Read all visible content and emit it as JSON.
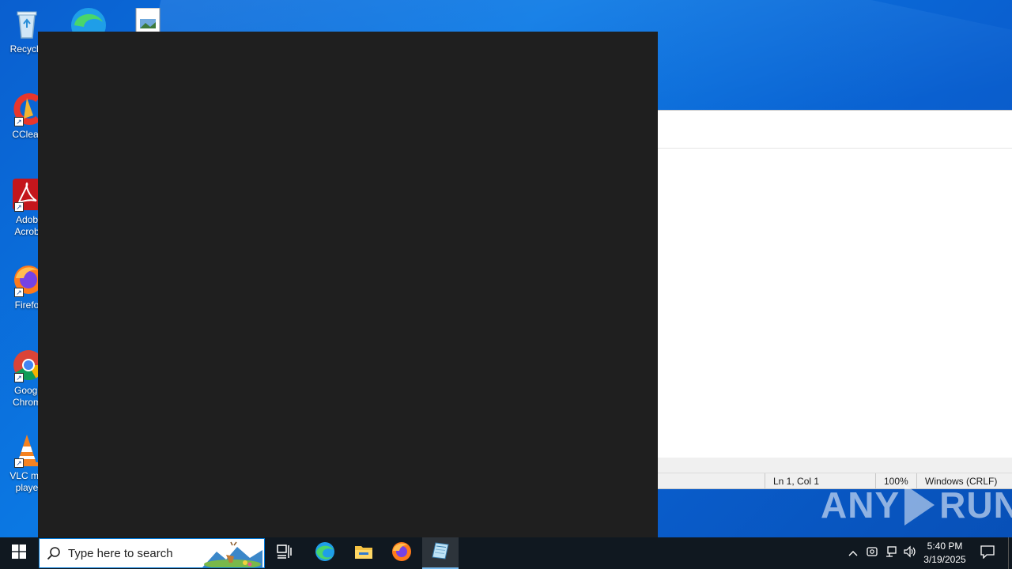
{
  "desktop": {
    "icons": [
      {
        "label": "Recycle",
        "icon": "recycle-bin-icon"
      },
      {
        "label": "CClear",
        "icon": "ccleaner-icon"
      },
      {
        "label": "Adob Acrob",
        "icon": "adobe-acrobat-icon"
      },
      {
        "label": "Firefo",
        "icon": "firefox-icon"
      },
      {
        "label": "Googl Chrom",
        "icon": "chrome-icon"
      },
      {
        "label": "VLC me playe",
        "icon": "vlc-icon"
      }
    ]
  },
  "notepad": {
    "status": {
      "position": "Ln 1, Col 1",
      "zoom": "100%",
      "line_ending": "Windows (CRLF)"
    }
  },
  "watermark": {
    "left": "ANY",
    "right": "RUN"
  },
  "taskbar": {
    "search_placeholder": "Type here to search",
    "clock": {
      "time": "5:40 PM",
      "date": "3/19/2025"
    }
  },
  "colors": {
    "desktop": "#0b78e3",
    "taskbar": "#101820",
    "dark_window": "#1f1f1f",
    "accent": "#0078d7"
  }
}
